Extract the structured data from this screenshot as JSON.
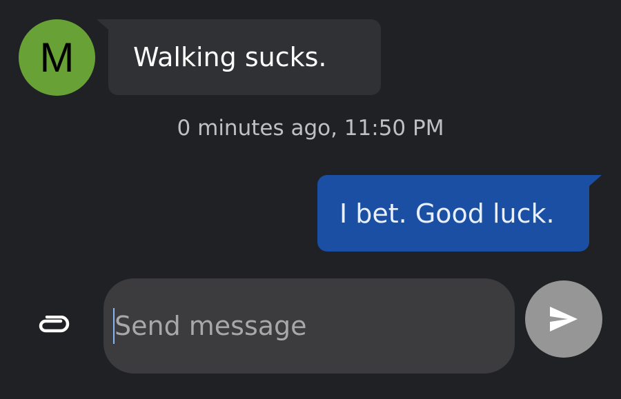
{
  "contact": {
    "initial": "M",
    "avatar_color": "#68a236"
  },
  "messages": [
    {
      "direction": "incoming",
      "text": "Walking sucks."
    },
    {
      "direction": "outgoing",
      "text": "I bet. Good luck.",
      "bubble_color": "#1a4fa3"
    }
  ],
  "timestamp": "0 minutes ago, 11:50 PM",
  "composer": {
    "placeholder": "Send message",
    "value": "",
    "attach_icon": "paperclip-icon",
    "send_icon": "send-icon"
  }
}
